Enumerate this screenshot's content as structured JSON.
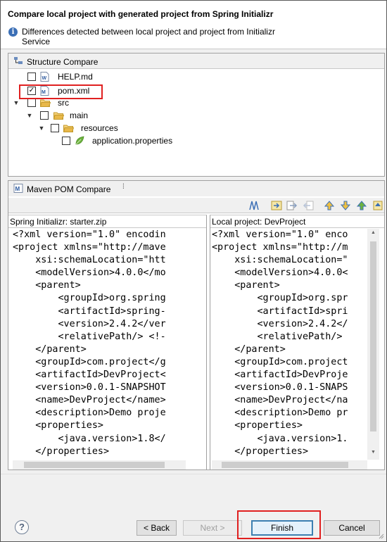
{
  "dialog": {
    "title": "Compare local project with generated project from Spring Initializr",
    "message": "Differences detected between local project and project from Initializr Service"
  },
  "structure": {
    "title": "Structure Compare",
    "items": [
      {
        "label": "HELP.md",
        "icon": "markdown-file-icon",
        "checked": false
      },
      {
        "label": "pom.xml",
        "icon": "maven-file-icon",
        "checked": true
      },
      {
        "label": "src",
        "icon": "folder-icon",
        "checked": false
      },
      {
        "label": "main",
        "icon": "folder-icon",
        "checked": false
      },
      {
        "label": "resources",
        "icon": "folder-icon",
        "checked": false
      },
      {
        "label": "application.properties",
        "icon": "spring-leaf-icon",
        "checked": false
      }
    ]
  },
  "maven": {
    "title": "Maven POM Compare",
    "left_title": "Spring Initializr: starter.zip",
    "right_title": "Local project: DevProject",
    "left_lines": [
      "<?xml version=\"1.0\" encodin",
      "<project xmlns=\"http://mave",
      "    xsi:schemaLocation=\"htt",
      "    <modelVersion>4.0.0</mo",
      "    <parent>",
      "        <groupId>org.spring",
      "        <artifactId>spring-",
      "        <version>2.4.2</ver",
      "        <relativePath/> <!-",
      "    </parent>",
      "    <groupId>com.project</g",
      "    <artifactId>DevProject<",
      "    <version>0.0.1-SNAPSHOT",
      "    <name>DevProject</name>",
      "    <description>Demo proje",
      "    <properties>",
      "        <java.version>1.8</",
      "    </properties>"
    ],
    "right_lines": [
      "<?xml version=\"1.0\" enco",
      "<project xmlns=\"http://m",
      "    xsi:schemaLocation=\"",
      "    <modelVersion>4.0.0<",
      "    <parent>",
      "        <groupId>org.spr",
      "        <artifactId>spri",
      "        <version>2.4.2</",
      "        <relativePath/>",
      "    </parent>",
      "    <groupId>com.project",
      "    <artifactId>DevProje",
      "    <version>0.0.1-SNAPS",
      "    <name>DevProject</na",
      "    <description>Demo pr",
      "    <properties>",
      "        <java.version>1.",
      "    </properties>"
    ]
  },
  "buttons": {
    "help": "?",
    "back": "< Back",
    "next": "Next >",
    "finish": "Finish",
    "cancel": "Cancel"
  },
  "colors": {
    "highlight": "#e02020",
    "folder": "#e8b84a",
    "spring": "#6db33f"
  }
}
